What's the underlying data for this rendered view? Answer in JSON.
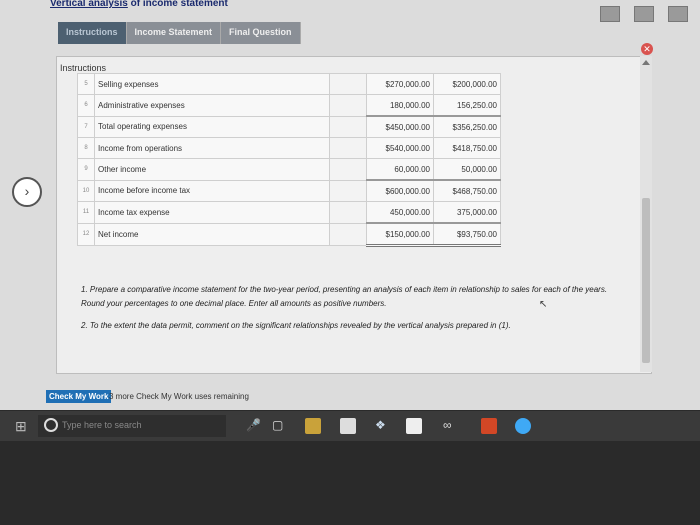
{
  "app": {
    "title_prefix": "Vertical analysis",
    "title_suffix": " of income statement"
  },
  "tabs": [
    {
      "label": "Instructions",
      "active": true
    },
    {
      "label": "Income Statement",
      "active": false
    },
    {
      "label": "Final Question",
      "active": false
    }
  ],
  "panel": {
    "title": "Instructions"
  },
  "table": {
    "rows": [
      {
        "num": "5",
        "label": "Selling expenses",
        "v1": "$270,000.00",
        "v2": "$200,000.00"
      },
      {
        "num": "6",
        "label": "Administrative expenses",
        "v1": "180,000.00",
        "v2": "156,250.00"
      },
      {
        "num": "7",
        "label": "Total operating expenses",
        "v1": "$450,000.00",
        "v2": "$356,250.00"
      },
      {
        "num": "8",
        "label": "Income from operations",
        "v1": "$540,000.00",
        "v2": "$418,750.00"
      },
      {
        "num": "9",
        "label": "Other income",
        "v1": "60,000.00",
        "v2": "50,000.00"
      },
      {
        "num": "10",
        "label": "Income before income tax",
        "v1": "$600,000.00",
        "v2": "$468,750.00"
      },
      {
        "num": "11",
        "label": "Income tax expense",
        "v1": "450,000.00",
        "v2": "375,000.00"
      },
      {
        "num": "12",
        "label": "Net income",
        "v1": "$150,000.00",
        "v2": "$93,750.00"
      }
    ]
  },
  "questions": [
    "1. Prepare a comparative income statement for the two-year period, presenting an analysis of each item in relationship to sales for each of the years. Round your percentages to one decimal place. Enter all amounts as positive numbers.",
    "2. To the extent the data permit, comment on the significant relationships revealed by the vertical analysis prepared in (1)."
  ],
  "footer": {
    "check_label": "Check My Work",
    "remaining": "3 more Check My Work uses remaining"
  },
  "taskbar": {
    "search_placeholder": "Type here to search"
  },
  "colors": {
    "title": "#1a2a6e",
    "tab_active": "#4d6071",
    "check_button": "#1f6fb5",
    "close": "#d9534f"
  }
}
